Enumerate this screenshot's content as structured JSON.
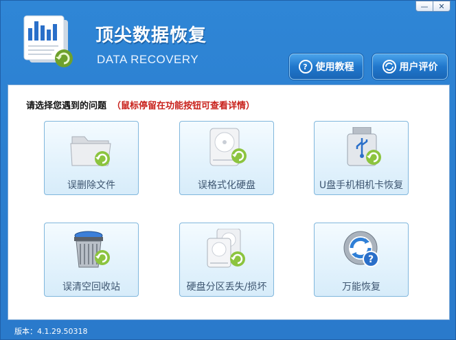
{
  "window": {
    "minimize_glyph": "—",
    "close_glyph": "✕"
  },
  "header": {
    "title": "顶尖数据恢复",
    "subtitle": "DATA RECOVERY",
    "logo_icon": "chart-document-recovery-icon"
  },
  "toolbar": {
    "help_label": "使用教程",
    "help_icon": "question-circle-icon",
    "review_label": "用户评价",
    "review_icon": "swirl-circle-icon"
  },
  "main": {
    "prompt": "请选择您遇到的问题",
    "hint": "（鼠标停留在功能按钮可查看详情）",
    "tiles": [
      {
        "label": "误删除文件",
        "icon": "folder-recover-icon"
      },
      {
        "label": "误格式化硬盘",
        "icon": "harddisk-recover-icon"
      },
      {
        "label": "U盘手机相机卡恢复",
        "icon": "usb-drive-recover-icon"
      },
      {
        "label": "误清空回收站",
        "icon": "recycle-bin-recover-icon"
      },
      {
        "label": "硬盘分区丢失/损坏",
        "icon": "partition-recover-icon"
      },
      {
        "label": "万能恢复",
        "icon": "universal-recover-icon"
      }
    ]
  },
  "footer": {
    "version": "版本：4.1.29.50318"
  },
  "colors": {
    "frame": "#2b7fd0",
    "hint": "#c8201a",
    "recover_green": "#8cc43f"
  }
}
